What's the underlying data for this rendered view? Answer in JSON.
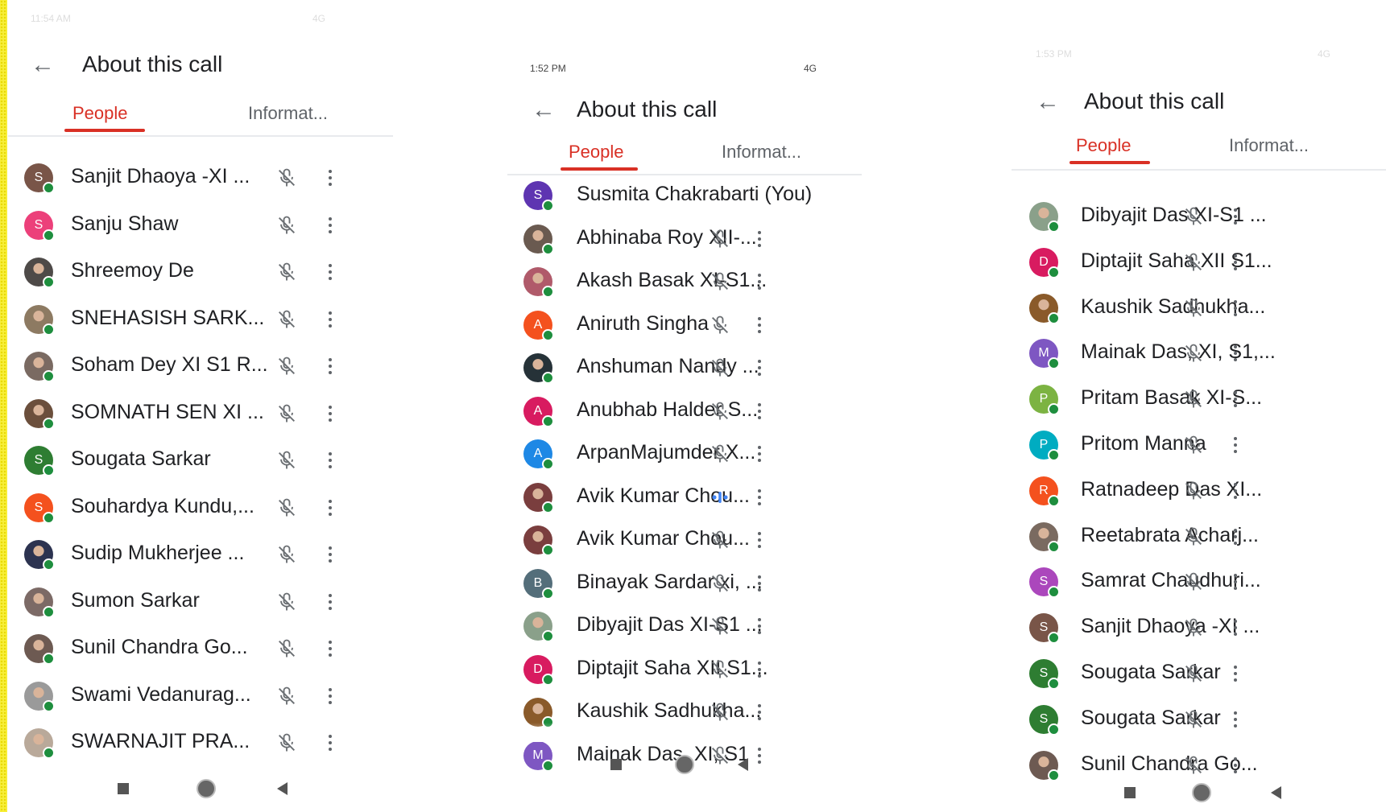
{
  "colors": {
    "accent_red": "#d93025",
    "online_green": "#1e8e3e",
    "speaking_blue": "#4285f4"
  },
  "icons": {
    "back": "arrow-left-icon",
    "muted": "mic-off-icon",
    "speaking": "audio-level-icon",
    "more": "more-vert-icon",
    "nav_recent": "square-icon",
    "nav_home": "circle-icon",
    "nav_back": "triangle-back-icon"
  },
  "panels": [
    {
      "status": {
        "time": "11:54 AM",
        "signal": "4G"
      },
      "title": "About this call",
      "tabs": [
        "People",
        "Informat..."
      ],
      "participants": [
        {
          "name": "Sanjit Dhaoya -XI ...",
          "initial": "S",
          "color": "#795548",
          "photo": false,
          "state": "muted"
        },
        {
          "name": "Sanju Shaw",
          "initial": "S",
          "color": "#ec407a",
          "photo": false,
          "state": "muted"
        },
        {
          "name": "Shreemoy De",
          "initial": "",
          "color": "#4e4a48",
          "photo": true,
          "state": "muted"
        },
        {
          "name": "SNEHASISH SARK...",
          "initial": "",
          "color": "#8d7a62",
          "photo": true,
          "state": "muted"
        },
        {
          "name": "Soham Dey XI S1 R...",
          "initial": "",
          "color": "#7a6a62",
          "photo": true,
          "state": "muted"
        },
        {
          "name": "SOMNATH SEN XI ...",
          "initial": "",
          "color": "#6b4f3c",
          "photo": true,
          "state": "muted"
        },
        {
          "name": "Sougata Sarkar",
          "initial": "S",
          "color": "#2e7d32",
          "photo": false,
          "state": "muted"
        },
        {
          "name": "Souhardya Kundu,...",
          "initial": "S",
          "color": "#f4511e",
          "photo": false,
          "state": "muted"
        },
        {
          "name": "Sudip Mukherjee ...",
          "initial": "",
          "color": "#2c3350",
          "photo": true,
          "state": "muted"
        },
        {
          "name": "Sumon Sarkar",
          "initial": "",
          "color": "#7c6a66",
          "photo": true,
          "state": "muted"
        },
        {
          "name": "Sunil Chandra Go...",
          "initial": "",
          "color": "#6d5a52",
          "photo": true,
          "state": "muted"
        },
        {
          "name": "Swami Vedanurag...",
          "initial": "",
          "color": "#9a9a9a",
          "photo": true,
          "state": "muted"
        },
        {
          "name": "SWARNAJIT PRA...",
          "initial": "",
          "color": "#b9a99a",
          "photo": true,
          "state": "muted"
        }
      ]
    },
    {
      "status": {
        "time": "1:52 PM",
        "signal": "4G"
      },
      "title": "About this call",
      "tabs": [
        "People",
        "Informat..."
      ],
      "participants": [
        {
          "name": "Susmita Chakrabarti (You)",
          "initial": "S",
          "color": "#5e35b1",
          "photo": false,
          "state": "none"
        },
        {
          "name": "Abhinaba Roy XII-...",
          "initial": "",
          "color": "#6a5a50",
          "photo": true,
          "state": "muted"
        },
        {
          "name": "Akash Basak XI-S1...",
          "initial": "",
          "color": "#b05a6a",
          "photo": true,
          "state": "muted"
        },
        {
          "name": "Aniruth Singha",
          "initial": "A",
          "color": "#f4511e",
          "photo": false,
          "state": "muted"
        },
        {
          "name": "Anshuman Nandy ...",
          "initial": "",
          "color": "#263238",
          "photo": true,
          "state": "muted"
        },
        {
          "name": "Anubhab Halder S...",
          "initial": "A",
          "color": "#d81b60",
          "photo": false,
          "state": "muted"
        },
        {
          "name": "ArpanMajumder X...",
          "initial": "A",
          "color": "#1e88e5",
          "photo": false,
          "state": "muted"
        },
        {
          "name": "Avik Kumar Chou...",
          "initial": "",
          "color": "#7a3e3e",
          "photo": true,
          "state": "speaking"
        },
        {
          "name": "Avik Kumar Chou...",
          "initial": "",
          "color": "#7a3e3e",
          "photo": true,
          "state": "muted"
        },
        {
          "name": "Binayak Sardar xi, ...",
          "initial": "B",
          "color": "#546e7a",
          "photo": false,
          "state": "muted"
        },
        {
          "name": "Dibyajit Das XI-S1 ...",
          "initial": "",
          "color": "#8aa08a",
          "photo": true,
          "state": "muted"
        },
        {
          "name": "Diptajit Saha XII S1...",
          "initial": "D",
          "color": "#d81b60",
          "photo": false,
          "state": "muted"
        },
        {
          "name": "Kaushik Sadhukha...",
          "initial": "",
          "color": "#8a5a2a",
          "photo": true,
          "state": "muted"
        },
        {
          "name": "Mainak Das, XI, S1",
          "initial": "M",
          "color": "#7e57c2",
          "photo": false,
          "state": "muted"
        }
      ]
    },
    {
      "status": {
        "time": "1:53 PM",
        "signal": "4G"
      },
      "title": "About this call",
      "tabs": [
        "People",
        "Informat..."
      ],
      "participants": [
        {
          "name": "Dibyajit Das XI-S1 ...",
          "initial": "",
          "color": "#8aa08a",
          "photo": true,
          "state": "muted"
        },
        {
          "name": "Diptajit Saha XII S1...",
          "initial": "D",
          "color": "#d81b60",
          "photo": false,
          "state": "muted"
        },
        {
          "name": "Kaushik Sadhukha...",
          "initial": "",
          "color": "#8a5a2a",
          "photo": true,
          "state": "muted"
        },
        {
          "name": "Mainak Das, XI, S1,...",
          "initial": "M",
          "color": "#7e57c2",
          "photo": false,
          "state": "muted"
        },
        {
          "name": "Pritam Basak XI-S...",
          "initial": "P",
          "color": "#7cb342",
          "photo": false,
          "state": "muted"
        },
        {
          "name": "Pritom Manna",
          "initial": "P",
          "color": "#00acc1",
          "photo": false,
          "state": "muted"
        },
        {
          "name": "Ratnadeep Das XI...",
          "initial": "R",
          "color": "#f4511e",
          "photo": false,
          "state": "muted"
        },
        {
          "name": "Reetabrata Acharj...",
          "initial": "",
          "color": "#7a6a60",
          "photo": true,
          "state": "muted"
        },
        {
          "name": "Samrat Chaudhuri...",
          "initial": "S",
          "color": "#ab47bc",
          "photo": false,
          "state": "muted"
        },
        {
          "name": "Sanjit Dhaoya -XI ...",
          "initial": "S",
          "color": "#795548",
          "photo": false,
          "state": "muted"
        },
        {
          "name": "Sougata Sarkar",
          "initial": "S",
          "color": "#2e7d32",
          "photo": false,
          "state": "muted"
        },
        {
          "name": "Sougata Sarkar",
          "initial": "S",
          "color": "#2e7d32",
          "photo": false,
          "state": "muted"
        },
        {
          "name": "Sunil Chandra Go...",
          "initial": "",
          "color": "#6d5a52",
          "photo": true,
          "state": "muted"
        }
      ]
    }
  ]
}
